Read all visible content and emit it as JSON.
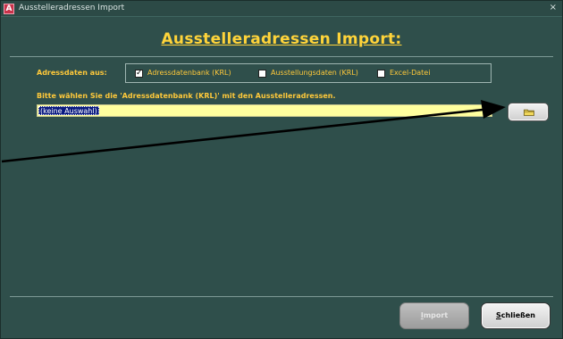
{
  "window": {
    "title": "Ausstelleradressen Import",
    "app_icon_letter": "A",
    "close_glyph": "×",
    "app_icon_color": "#c8324a"
  },
  "header": {
    "title": "Ausstelleradressen Import:",
    "title_color": "#ffd43a"
  },
  "source": {
    "label": "Adressdaten aus:",
    "options": [
      {
        "label": "Adressdatenbank (KRL)",
        "checked": true
      },
      {
        "label": "Ausstellungsdaten (KRL)",
        "checked": false
      },
      {
        "label": "Excel-Datei",
        "checked": false
      }
    ],
    "check_glyph": "✓"
  },
  "file": {
    "hint": "Bitte wählen Sie die 'Adressdatenbank (KRL)' mit den Ausstelleradressen.",
    "value": "(keine Auswahl)",
    "browse_icon": "folder-icon"
  },
  "buttons": {
    "import": {
      "first": "I",
      "rest": "mport",
      "enabled": false
    },
    "close": {
      "first": "S",
      "rest": "chließen",
      "enabled": true
    }
  },
  "colors": {
    "background": "#2f4f4b",
    "label_text": "#ffc93a",
    "field_background": "#ffff9e",
    "selection": "#0a1a80"
  }
}
